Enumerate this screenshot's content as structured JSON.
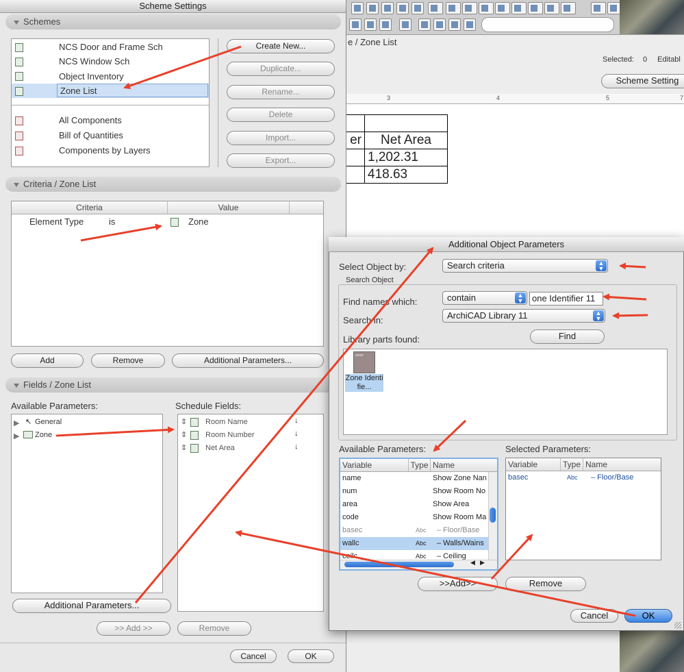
{
  "scheme_settings": {
    "title": "Scheme Settings",
    "schemes": {
      "header": "Schemes",
      "items": [
        {
          "label": "NCS Door and Frame Sch"
        },
        {
          "label": "NCS Window Sch"
        },
        {
          "label": "Object Inventory"
        },
        {
          "label": "Zone List"
        }
      ],
      "component_items": [
        {
          "label": "All Components"
        },
        {
          "label": "Bill of Quantities"
        },
        {
          "label": "Components by Layers"
        }
      ],
      "buttons": [
        "Create New...",
        "Duplicate...",
        "Rename...",
        "Delete",
        "Import...",
        "Export..."
      ]
    },
    "criteria": {
      "header": "Criteria /  Zone List",
      "col_criteria": "Criteria",
      "col_value": "Value",
      "row": {
        "element": "Element Type",
        "op": "is",
        "value": "Zone"
      },
      "add": "Add",
      "remove": "Remove",
      "additional": "Additional Parameters..."
    },
    "fields": {
      "header": "Fields /  Zone List",
      "available_label": "Available Parameters:",
      "schedule_label": "Schedule Fields:",
      "available": [
        "General",
        "Zone"
      ],
      "schedule": [
        "Room Name",
        "Room Number",
        "Net Area"
      ],
      "additional": "Additional Parameters...",
      "add": ">> Add >>",
      "remove": "Remove"
    },
    "cancel": "Cancel",
    "ok": "OK"
  },
  "background": {
    "breadcrumb": "e /  Zone List",
    "selected_label": "Selected:",
    "selected_count": "0",
    "editable_label": "Editabl",
    "scheme_settings_button": "Scheme Setting",
    "ruler_ticks": [
      "3",
      "4",
      "5",
      "6",
      "7"
    ],
    "table": {
      "header": [
        "er",
        "Net Area"
      ],
      "rows": [
        [
          "",
          "1,202.31"
        ],
        [
          "",
          "418.63"
        ]
      ]
    }
  },
  "additional_object_parameters": {
    "title": "Additional Object Parameters",
    "select_by_label": "Select Object by:",
    "select_by_value": "Search criteria",
    "search_object_label": "Search Object",
    "find_names_label": "Find names which:",
    "find_mode": "contain",
    "find_text": "one Identifier 11",
    "search_in_label": "Search in:",
    "search_in_value": "ArchiCAD Library 11",
    "find_button": "Find",
    "found_label": "Library parts found:",
    "found_item": "Zone Identifie...",
    "available_label": "Available Parameters:",
    "selected_label": "Selected Parameters:",
    "columns": [
      "Variable",
      "Type",
      "Name"
    ],
    "available_rows": [
      {
        "variable": "name",
        "type": "check",
        "name": "Show Zone Nan"
      },
      {
        "variable": "num",
        "type": "check",
        "name": "Show Room No"
      },
      {
        "variable": "area",
        "type": "check",
        "name": "Show Area"
      },
      {
        "variable": "code",
        "type": "check",
        "name": "Show Room Ma"
      },
      {
        "variable": "basec",
        "type": "Abc",
        "name": "– Floor/Base"
      },
      {
        "variable": "wallc",
        "type": "Abc",
        "name": "– Walls/Wains"
      },
      {
        "variable": "ceilc",
        "type": "Abc",
        "name": "– Ceiling"
      }
    ],
    "selected_rows": [
      {
        "variable": "basec",
        "type": "Abc",
        "name": "– Floor/Base"
      }
    ],
    "add": ">>Add>>",
    "remove": "Remove",
    "cancel": "Cancel",
    "ok": "OK"
  },
  "colors": {
    "annotation_arrow": "#e8402a",
    "selection": "#b7d4f2",
    "ok_button": "#3a82e2"
  }
}
